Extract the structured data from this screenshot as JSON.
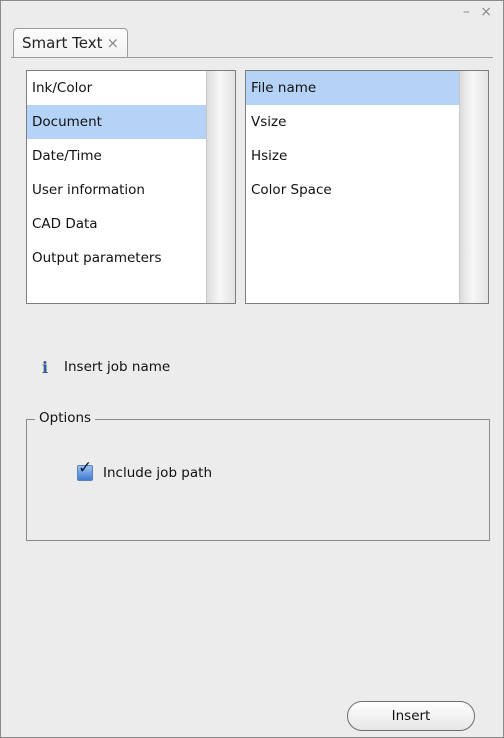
{
  "window": {
    "controls": "– ×"
  },
  "tab": {
    "label": "Smart Text",
    "close_glyph": "×"
  },
  "categories": {
    "items": [
      {
        "label": "Ink/Color",
        "selected": false
      },
      {
        "label": "Document",
        "selected": true
      },
      {
        "label": "Date/Time",
        "selected": false
      },
      {
        "label": "User information",
        "selected": false
      },
      {
        "label": "CAD Data",
        "selected": false
      },
      {
        "label": "Output parameters",
        "selected": false
      }
    ]
  },
  "fields": {
    "items": [
      {
        "label": "File name",
        "selected": true
      },
      {
        "label": "Vsize",
        "selected": false
      },
      {
        "label": "Hsize",
        "selected": false
      },
      {
        "label": "Color Space",
        "selected": false
      }
    ]
  },
  "info": {
    "icon": "info-icon",
    "text": "Insert job name"
  },
  "options": {
    "legend": "Options",
    "include_job_path": {
      "label": "Include job path",
      "checked": true
    }
  },
  "actions": {
    "insert_label": "Insert"
  }
}
